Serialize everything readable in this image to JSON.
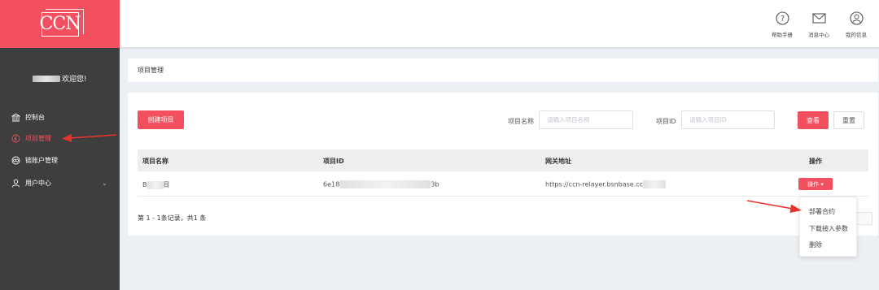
{
  "brand": {
    "logo": "CCN",
    "accent": "#f2505f"
  },
  "sidebar": {
    "greeting": "欢迎您!",
    "items": [
      {
        "label": "控制台",
        "icon": "bank-icon"
      },
      {
        "label": "项目管理",
        "icon": "project-icon",
        "active": true
      },
      {
        "label": "链账户管理",
        "icon": "chain-account-icon"
      },
      {
        "label": "用户中心",
        "icon": "user-icon",
        "expandable": true
      }
    ]
  },
  "header": {
    "items": [
      {
        "label": "帮助手册",
        "icon": "help-icon"
      },
      {
        "label": "消息中心",
        "icon": "mail-icon"
      },
      {
        "label": "我的信息",
        "icon": "profile-icon"
      }
    ]
  },
  "breadcrumb": {
    "title": "项目管理"
  },
  "toolbar": {
    "create_label": "创建项目",
    "name_label": "项目名称",
    "name_placeholder": "请输入项目名称",
    "id_label": "项目ID",
    "id_placeholder": "请输入项目ID",
    "search_label": "查看",
    "reset_label": "重置"
  },
  "table": {
    "columns": [
      "项目名称",
      "项目ID",
      "网关地址",
      "操作"
    ],
    "rows": [
      {
        "name_prefix": "B",
        "name_suffix": "目",
        "id_prefix": "6e18",
        "id_suffix": "3b",
        "gateway": "https://ccn-relayer.bsnbase.cc",
        "action_label": "操作 ▾"
      }
    ]
  },
  "pagination": {
    "summary": "第 1 - 1条记录，共1 条"
  },
  "dropdown": {
    "items": [
      "部署合约",
      "下载接入参数",
      "删除"
    ]
  }
}
